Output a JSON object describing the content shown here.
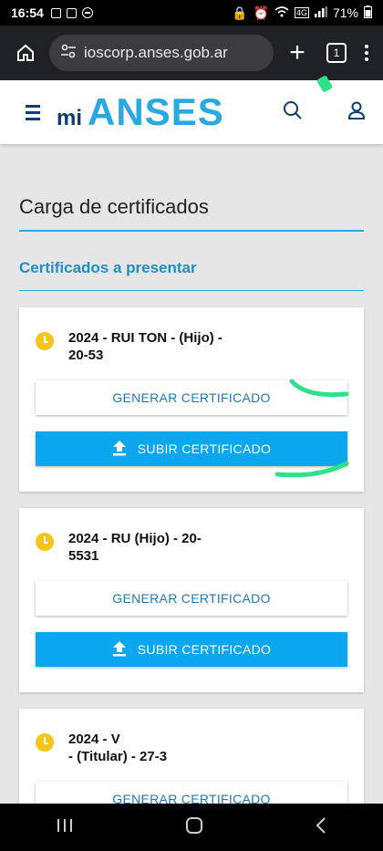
{
  "status": {
    "time": "16:54",
    "network": "4G",
    "battery": "71%"
  },
  "browser": {
    "url": "ioscorp.anses.gob.ar",
    "tab_count": "1"
  },
  "header": {
    "logo_mi": "mi",
    "logo_brand": "ANSES"
  },
  "page": {
    "title": "Carga de certificados",
    "subtitle": "Certificados a presentar"
  },
  "cards": [
    {
      "line1": "2024 - RUI                    TON - (Hijo) -",
      "line2": "20-53",
      "generate_label": "GENERAR CERTIFICADO",
      "upload_label": "SUBIR CERTIFICADO"
    },
    {
      "line1": "2024 - RU                       (Hijo) - 20-",
      "line2": "5531",
      "generate_label": "GENERAR CERTIFICADO",
      "upload_label": "SUBIR CERTIFICADO"
    },
    {
      "line1": "2024 - V",
      "line2": "- (Titular) - 27-3",
      "generate_label": "GENERAR CERTIFICADO"
    }
  ],
  "colors": {
    "brand_blue": "#29a9e0",
    "navy": "#0a3d73",
    "upload_button": "#0aa6ee",
    "pending_icon": "#f5c518"
  }
}
